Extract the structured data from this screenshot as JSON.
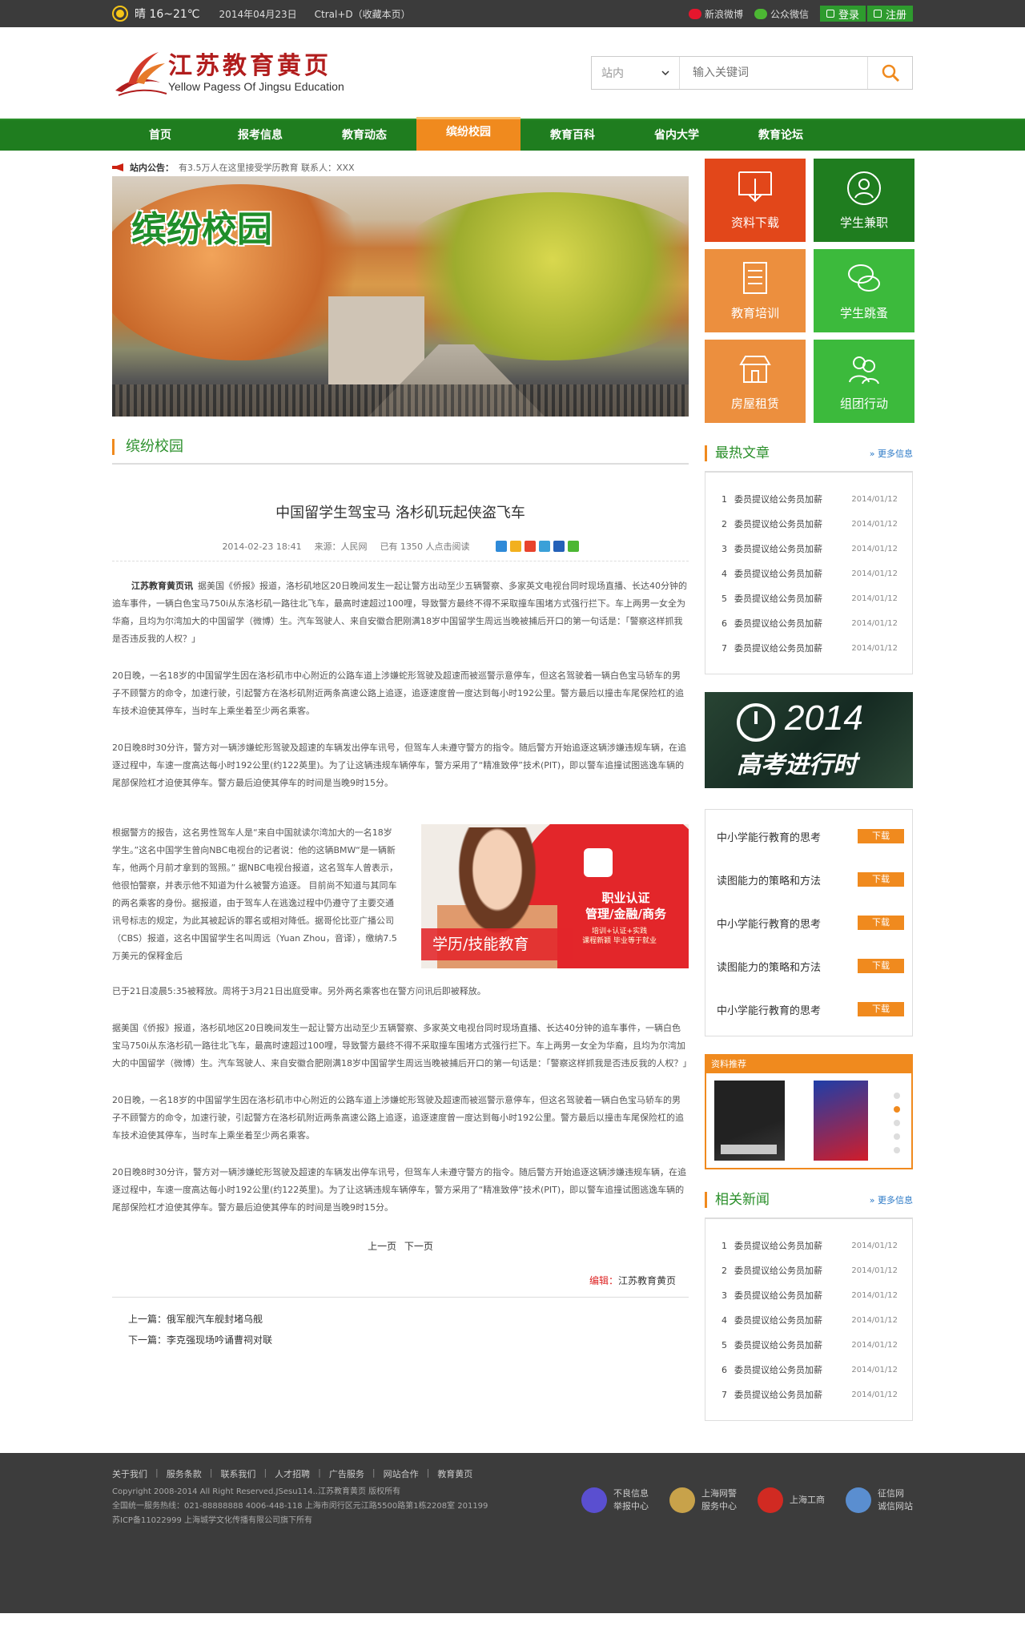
{
  "topbar": {
    "weather": "晴 16~21℃",
    "date": "2014年04月23日",
    "favorite": "Ctral+D（收藏本页）",
    "weibo": "新浪微博",
    "wechat": "公众微信",
    "login": "登录",
    "register": "注册"
  },
  "header": {
    "logo_cn": "江苏教育黄页",
    "logo_en": "Yellow Pagess Of Jingsu Education",
    "search_scope": "站内",
    "search_placeholder": "输入关键词"
  },
  "nav": [
    "首页",
    "报考信息",
    "教育动态",
    "缤纷校园",
    "教育百科",
    "省内大学",
    "教育论坛"
  ],
  "notice": {
    "label": "站内公告：",
    "text": "有3.5万人在这里接受学历教育    联系人：XXX"
  },
  "banner_title": "缤纷校园",
  "section_title": "缤纷校园",
  "article": {
    "title": "中国留学生驾宝马 洛杉矶玩起侠盗飞车",
    "date": "2014-02-23  18:41",
    "source": "来源：人民网",
    "views": "已有 1350 人点击阅读",
    "lead": "江苏教育黄页讯",
    "p1": "据美国《侨报》报道，洛杉矶地区20日晚间发生一起让警方出动至少五辆警察、多家英文电视台同时现场直播、长达40分钟的追车事件，一辆白色宝马750i从东洛杉矶一路往北飞车，最高时速超过100哩，导致警方最终不得不采取撞车围堵方式强行拦下。车上两男一女全为华裔，且均为尔湾加大的中国留学（微博）生。汽车驾驶人、来自安徽合肥刚满18岁中国留学生周远当晚被捕后开口的第一句话是：「警察这样抓我是否违反我的人权？」",
    "p2": "20日晚，一名18岁的中国留学生因在洛杉矶市中心附近的公路车道上涉嫌蛇形驾驶及超速而被巡警示意停车，但这名驾驶着一辆白色宝马轿车的男子不顾警方的命令，加速行驶，引起警方在洛杉矶附近两条高速公路上追逐，追逐速度曾一度达到每小时192公里。警方最后以撞击车尾保险杠的追车技术迫使其停车，当时车上乘坐着至少两名乘客。",
    "p3": "20日晚8时30分许，警方对一辆涉嫌蛇形驾驶及超速的车辆发出停车讯号，但驾车人未遵守警方的指令。随后警方开始追逐这辆涉嫌违规车辆，在追逐过程中，车速一度高达每小时192公里(约122英里)。为了让这辆违规车辆停车，警方采用了“精准致停”技术(PIT)，即以警车追撞试图逃逸车辆的尾部保险杠才迫使其停车。警方最后迫使其停车的时间是当晚9时15分。",
    "p4": "根据警方的报告，这名男性驾车人是“来自中国就读尔湾加大的一名18岁学生。”这名中国学生曾向NBC电视台的记者说：他的这辆BMW“是一辆新车，他两个月前才拿到的驾照。” 据NBC电视台报道，这名驾车人曾表示，他很怕警察，并表示他不知道为什么被警方追逐。 目前尚不知道与其同车的两名乘客的身份。据报道，由于驾车人在逃逸过程中仍遵守了主要交通讯号标志的规定，为此其被起诉的罪名或相对降低。据哥伦比亚广播公司（CBS）报道，这名中国留学生名叫周远（Yuan Zhou，音译），缴纳7.5万美元的保释金后",
    "p5": "已于21日凌晨5:35被释放。周将于3月21日出庭受审。另外两名乘客也在警方问讯后即被释放。",
    "p6": "据美国《侨报》报道，洛杉矶地区20日晚间发生一起让警方出动至少五辆警察、多家英文电视台同时现场直播、长达40分钟的追车事件，一辆白色宝马750i从东洛杉矶一路往北飞车，最高时速超过100哩，导致警方最终不得不采取撞车围堵方式强行拦下。车上两男一女全为华裔，且均为尔湾加大的中国留学（微博）生。汽车驾驶人、来自安徽合肥刚满18岁中国留学生周远当晚被捕后开口的第一句话是：「警察这样抓我是否违反我的人权？」",
    "p7": "20日晚，一名18岁的中国留学生因在洛杉矶市中心附近的公路车道上涉嫌蛇形驾驶及超速而被巡警示意停车，但这名驾驶着一辆白色宝马轿车的男子不顾警方的命令，加速行驶，引起警方在洛杉矶附近两条高速公路上追逐，追逐速度曾一度达到每小时192公里。警方最后以撞击车尾保险杠的追车技术迫使其停车，当时车上乘坐着至少两名乘客。",
    "p8": "20日晚8时30分许，警方对一辆涉嫌蛇形驾驶及超速的车辆发出停车讯号，但驾车人未遵守警方的指令。随后警方开始追逐这辆涉嫌违规车辆，在追逐过程中，车速一度高达每小时192公里(约122英里)。为了让这辆违规车辆停车，警方采用了“精准致停”技术(PIT)，即以警车追撞试图逃逸车辆的尾部保险杠才迫使其停车。警方最后迫使其停车的时间是当晚9时15分。",
    "prev_page": "上一页",
    "next_page": "下一页",
    "editor_label": "编辑：",
    "editor": "江苏教育黄页",
    "prev_article": "上一篇：俄军舰汽车舰封堵乌舰",
    "next_article": "下一篇：李克强现场吟诵曹祠对联"
  },
  "ad": {
    "headline": "职业认证\n管理/金融/商务",
    "sub": "培训+认证+实践\n课程新颖 毕业等于就业",
    "strip": "学历/技能教育"
  },
  "tiles": [
    {
      "label": "资料下载",
      "icon": "download-icon"
    },
    {
      "label": "学生兼职",
      "icon": "user-icon"
    },
    {
      "label": "教育培训",
      "icon": "document-icon"
    },
    {
      "label": "学生跳蚤",
      "icon": "chat-icon"
    },
    {
      "label": "房屋租赁",
      "icon": "house-icon"
    },
    {
      "label": "组团行动",
      "icon": "group-icon"
    }
  ],
  "hot": {
    "title": "最热文章",
    "more": "更多信息",
    "items": [
      {
        "n": "1",
        "t": "委员提议给公务员加薪",
        "d": "2014/01/12"
      },
      {
        "n": "2",
        "t": "委员提议给公务员加薪",
        "d": "2014/01/12"
      },
      {
        "n": "3",
        "t": "委员提议给公务员加薪",
        "d": "2014/01/12"
      },
      {
        "n": "4",
        "t": "委员提议给公务员加薪",
        "d": "2014/01/12"
      },
      {
        "n": "5",
        "t": "委员提议给公务员加薪",
        "d": "2014/01/12"
      },
      {
        "n": "6",
        "t": "委员提议给公务员加薪",
        "d": "2014/01/12"
      },
      {
        "n": "7",
        "t": "委员提议给公务员加薪",
        "d": "2014/01/12"
      }
    ]
  },
  "gaokao": {
    "year": "2014",
    "text": "高考进行时"
  },
  "downloads": {
    "button": "下载",
    "items": [
      "中小学能行教育的思考",
      "读图能力的策略和方法",
      "中小学能行教育的思考",
      "读图能力的策略和方法",
      "中小学能行教育的思考"
    ]
  },
  "recommend": {
    "title": "资料推荐"
  },
  "related": {
    "title": "相关新闻",
    "more": "更多信息",
    "items": [
      {
        "n": "1",
        "t": "委员提议给公务员加薪",
        "d": "2014/01/12"
      },
      {
        "n": "2",
        "t": "委员提议给公务员加薪",
        "d": "2014/01/12"
      },
      {
        "n": "3",
        "t": "委员提议给公务员加薪",
        "d": "2014/01/12"
      },
      {
        "n": "4",
        "t": "委员提议给公务员加薪",
        "d": "2014/01/12"
      },
      {
        "n": "5",
        "t": "委员提议给公务员加薪",
        "d": "2014/01/12"
      },
      {
        "n": "6",
        "t": "委员提议给公务员加薪",
        "d": "2014/01/12"
      },
      {
        "n": "7",
        "t": "委员提议给公务员加薪",
        "d": "2014/01/12"
      }
    ]
  },
  "footer": {
    "links": [
      "关于我们",
      "服务条款",
      "联系我们",
      "人才招聘",
      "广告服务",
      "网站合作",
      "教育黄页"
    ],
    "copyright": "Copyright 2008-2014 All Right Reserved.JSesu114..江苏教育黄页 版权所有",
    "hotline": "全国统一服务热线：021-88888888 4006-448-118  上海市闵行区元江路5500路第1栋2208室 201199",
    "icp": "苏ICP备11022999  上海城学文化传播有限公司旗下所有",
    "certs": [
      {
        "l1": "不良信息",
        "l2": "举报中心",
        "color": "#5a4fd0"
      },
      {
        "l1": "上海网警",
        "l2": "服务中心",
        "color": "#c8a24a"
      },
      {
        "l1": "上海工商",
        "l2": "",
        "color": "#d12a22"
      },
      {
        "l1": "征信网",
        "l2": "诚信网站",
        "color": "#5a8ed0"
      }
    ]
  }
}
